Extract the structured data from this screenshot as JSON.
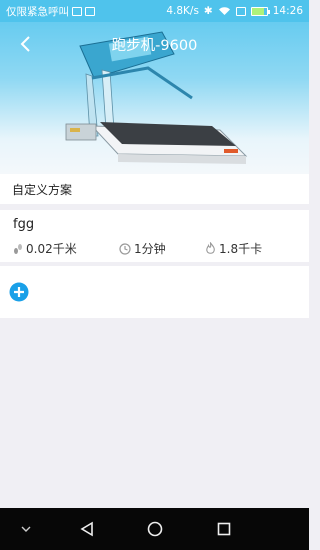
{
  "status_bar": {
    "carrier": "仅限紧急呼叫",
    "speed": "4.8K/s",
    "time": "14:26",
    "icons": [
      "sim-icon",
      "image-icon",
      "bluetooth-icon",
      "wifi-icon",
      "sim-card-icon",
      "battery-icon"
    ]
  },
  "header": {
    "title": "跑步机-9600",
    "back_icon": "chevron-left-icon"
  },
  "section": {
    "label": "自定义方案"
  },
  "plans": [
    {
      "name": "fgg",
      "distance": "0.02千米",
      "duration": "1分钟",
      "calories": "1.8千卡"
    }
  ],
  "colors": {
    "accent": "#4fc3ec",
    "add_button": "#1aa0e8",
    "background": "#f0eff4"
  },
  "nav": {
    "icons": [
      "chevron-down-icon",
      "back-triangle-icon",
      "home-circle-icon",
      "recents-square-icon"
    ]
  }
}
